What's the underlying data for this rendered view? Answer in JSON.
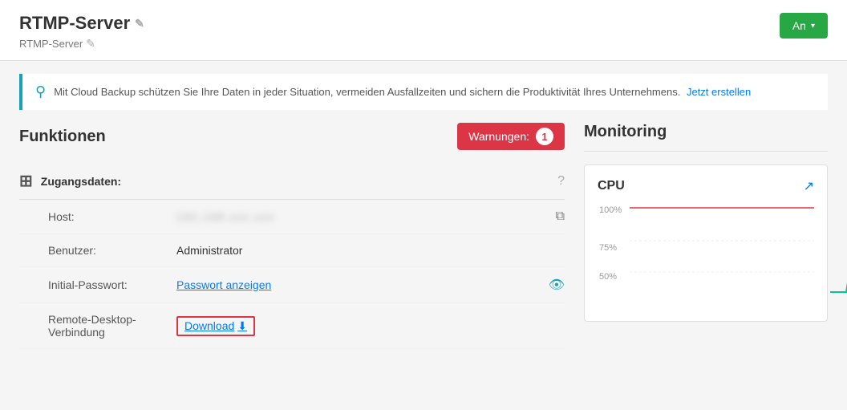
{
  "header": {
    "title": "RTMP-Server",
    "subtitle": "RTMP-Server",
    "edit_icon": "✎",
    "btn_label": "An",
    "caret": "▾"
  },
  "banner": {
    "icon": "⚲",
    "text": "Mit Cloud Backup schützen Sie Ihre Daten in jeder Situation, vermeiden Ausfallzeiten und sichern die Produktivität Ihres Unternehmens.",
    "link_label": "Jetzt erstellen"
  },
  "funktionen": {
    "title": "Funktionen",
    "warnungen_label": "Warnungen:",
    "warnungen_count": "1",
    "zugangsdaten": {
      "label": "Zugangsdaten:",
      "fields": [
        {
          "label": "Host:",
          "value": "••••••••••••",
          "blurred": true,
          "action": "copy",
          "action_icon": "⧉"
        },
        {
          "label": "Benutzer:",
          "value": "Administrator",
          "blurred": false,
          "action": "",
          "action_icon": ""
        },
        {
          "label": "Initial-Passwort:",
          "value": "Passwort anzeigen",
          "is_link": true,
          "action": "eye",
          "action_icon": "👁"
        },
        {
          "label": "Remote-Desktop-Verbindung",
          "value": "Download ⬇",
          "is_download": true,
          "action": "",
          "action_icon": ""
        }
      ]
    }
  },
  "monitoring": {
    "title": "Monitoring",
    "cpu": {
      "title": "CPU",
      "link_icon": "↗",
      "labels": [
        "100%",
        "75%",
        "50%"
      ],
      "gridlines": [
        0,
        25,
        50
      ]
    }
  }
}
